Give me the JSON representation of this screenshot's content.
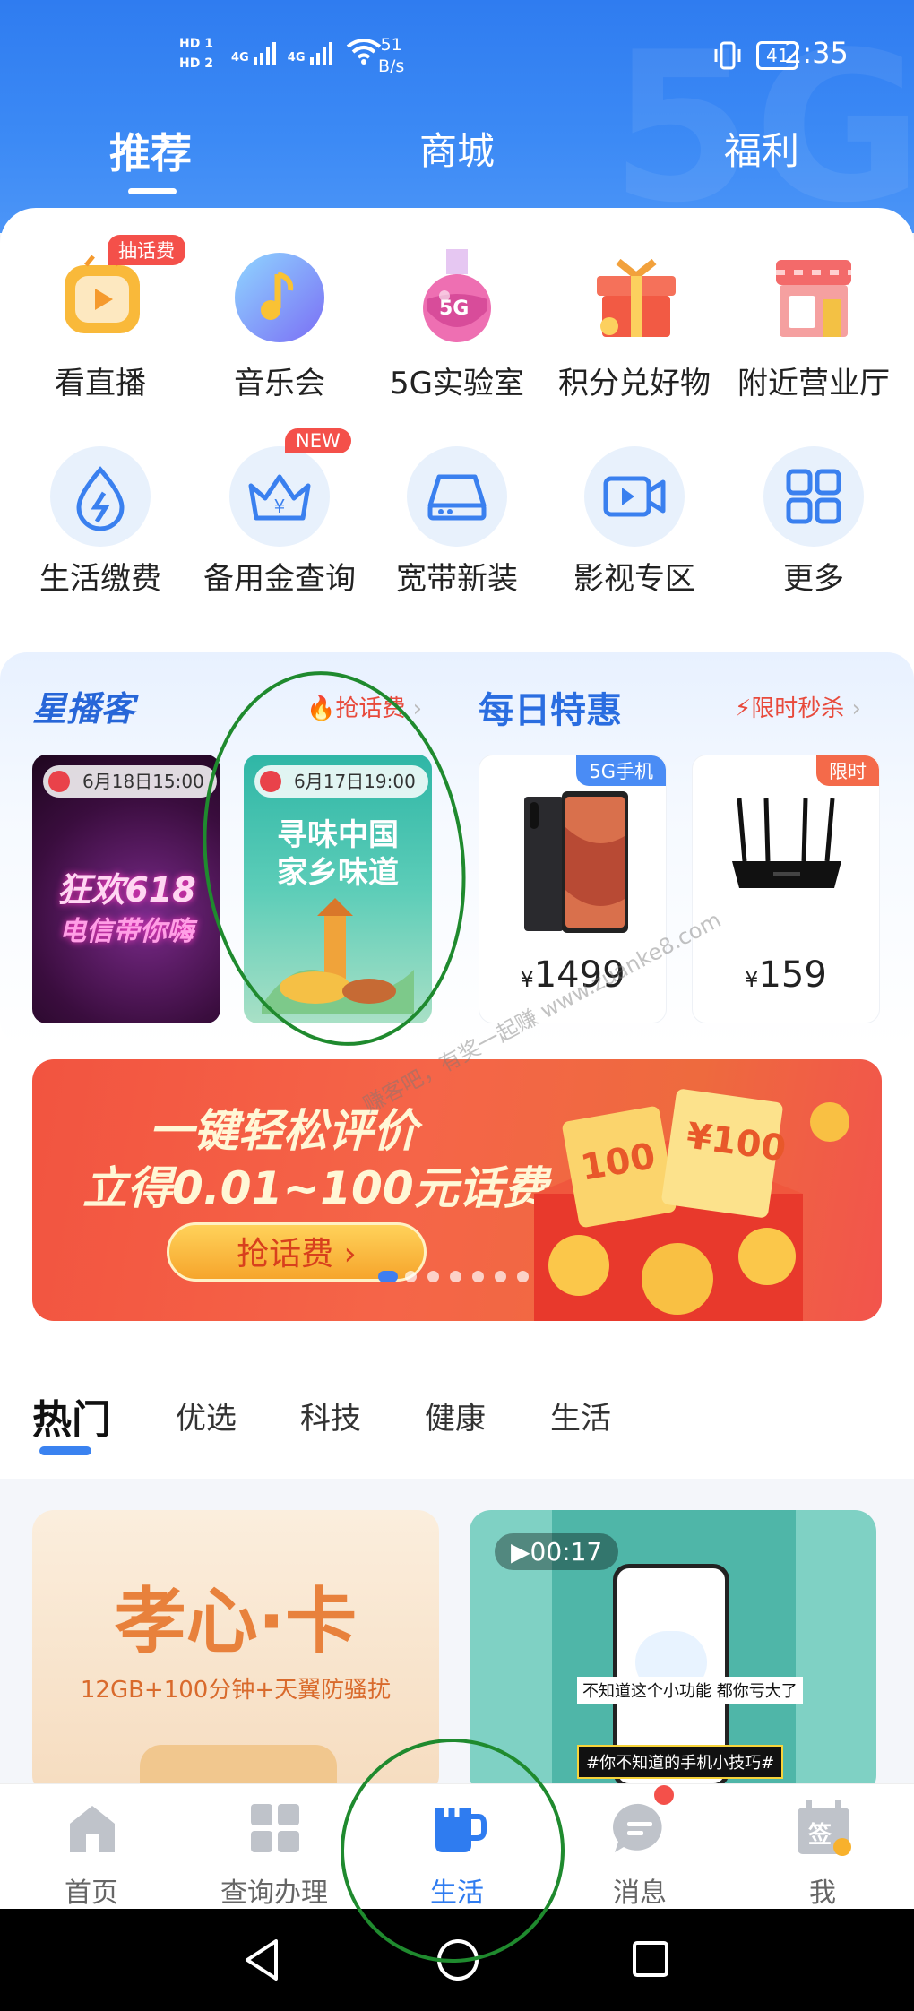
{
  "status_bar": {
    "hd1": "HD 1",
    "hd2": "HD 2",
    "signal1": "4G",
    "signal2": "4G",
    "net_speed_value": "51",
    "net_speed_unit": "B/s",
    "battery": "41",
    "time": "2:35"
  },
  "header": {
    "tabs": [
      {
        "label": "推荐",
        "active": true
      },
      {
        "label": "商城",
        "active": false
      },
      {
        "label": "福利",
        "active": false
      }
    ],
    "watermark": "5G"
  },
  "grid_row1": [
    {
      "label": "看直播",
      "icon": "tv-play-icon",
      "badge": "抽话费"
    },
    {
      "label": "音乐会",
      "icon": "music-note-icon"
    },
    {
      "label": "5G实验室",
      "icon": "flask-5g-icon",
      "icon_text": "5G"
    },
    {
      "label": "积分兑好物",
      "icon": "gift-box-icon"
    },
    {
      "label": "附近营业厅",
      "icon": "store-icon"
    }
  ],
  "grid_row2": [
    {
      "label": "生活缴费",
      "icon": "water-lightning-icon"
    },
    {
      "label": "备用金查询",
      "icon": "crown-yen-icon",
      "badge": "NEW"
    },
    {
      "label": "宽带新装",
      "icon": "router-icon"
    },
    {
      "label": "影视专区",
      "icon": "video-camera-icon"
    },
    {
      "label": "更多",
      "icon": "more-grid-icon"
    }
  ],
  "promo": {
    "left_title": "星播客",
    "left_tag": "抢话费",
    "right_title": "每日特惠",
    "right_tag": "限时秒杀",
    "live_cards": [
      {
        "time": "6月18日15:00",
        "line1": "狂欢618",
        "line2": "电信带你嗨"
      },
      {
        "time": "6月17日19:00",
        "line1": "寻味中国",
        "line2": "家乡味道"
      }
    ],
    "products": [
      {
        "tag": "5G手机",
        "currency": "¥",
        "price": "1499",
        "tag_color": "#4a8cf5"
      },
      {
        "tag": "限时",
        "currency": "¥",
        "price": "159",
        "tag_color": "#f46a4a"
      }
    ]
  },
  "banner": {
    "line1": "一键轻松评价",
    "line2": "立得0.01~100元话费",
    "button": "抢话费",
    "coupon1": "100",
    "coupon2": "¥100",
    "slide_count": 7,
    "active_slide": 1
  },
  "watermark_text": "赚客吧，有奖一起赚 www.zuanke8.com",
  "categories": [
    {
      "label": "热门",
      "active": true
    },
    {
      "label": "优选",
      "active": false
    },
    {
      "label": "科技",
      "active": false
    },
    {
      "label": "健康",
      "active": false
    },
    {
      "label": "生活",
      "active": false
    }
  ],
  "feed": {
    "left_title": "孝心·卡",
    "left_sub": "12GB+100分钟+天翼防骚扰",
    "right_duration": "00:17",
    "right_caption": "不知道这个小功能 都你亏大了",
    "right_hashtag": "#你不知道的手机小技巧#"
  },
  "bottom_nav": [
    {
      "label": "首页",
      "icon": "home-icon",
      "active": false
    },
    {
      "label": "查询办理",
      "icon": "grid-apps-icon",
      "active": false
    },
    {
      "label": "生活",
      "icon": "cup-icon",
      "active": true
    },
    {
      "label": "消息",
      "icon": "message-icon",
      "active": false,
      "dot": true
    },
    {
      "label": "我",
      "icon": "sign-in-calendar-icon",
      "active": false,
      "icon_text": "签"
    }
  ],
  "colors": {
    "header_blue": "#2f7cf0",
    "accent_red": "#f4504a",
    "active_nav": "#2f7cf0"
  }
}
